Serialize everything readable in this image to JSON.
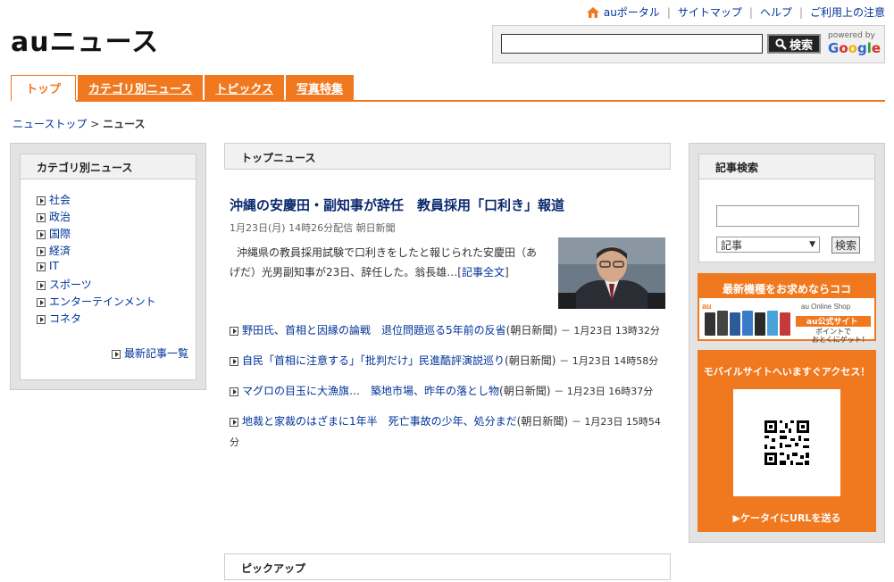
{
  "logo": {
    "text": "auニュース"
  },
  "topnav": {
    "items": [
      "auポータル",
      "サイトマップ",
      "ヘルプ",
      "ご利用上の注意"
    ]
  },
  "search": {
    "button_label": "検索",
    "powered_by": "powered by",
    "provider": "Google"
  },
  "tabs": [
    "トップ",
    "カテゴリ別ニュース",
    "トピックス",
    "写真特集"
  ],
  "breadcrumb": {
    "parent": "ニューストップ",
    "current": "ニュース"
  },
  "sidebar_left": {
    "title": "カテゴリ別ニュース",
    "categories": [
      "社会",
      "政治",
      "国際",
      "経済",
      "IT",
      "スポーツ",
      "エンターテインメント",
      "コネタ"
    ],
    "more_link": "最新記事一覧"
  },
  "top_news": {
    "section_title": "トップニュース",
    "headline": "沖縄の安慶田・副知事が辞任　教員採用「口利き」報道",
    "meta": "1月23日(月) 14時26分配信 朝日新聞",
    "body": "沖縄県の教員採用試験で口利きをしたと報じられた安慶田（あげだ）光男副知事が23日、辞任した。翁長雄…",
    "read_more": "記事全文",
    "items": [
      {
        "title": "野田氏、首相と因縁の論戦　退位問題巡る5年前の反省",
        "source": "(朝日新聞)",
        "time": "－ 1月23日 13時32分"
      },
      {
        "title": "自民「首相に注意する」「批判だけ」民進酷評演説巡り",
        "source": "(朝日新聞)",
        "time": "－ 1月23日 14時58分"
      },
      {
        "title": "マグロの目玉に大漁旗…　築地市場、昨年の落とし物",
        "source": "(朝日新聞)",
        "time": "－ 1月23日 16時37分"
      },
      {
        "title": "地裁と家裁のはざまに1年半　死亡事故の少年、処分まだ",
        "source": "(朝日新聞)",
        "time": "－ 1月23日 15時54分"
      }
    ]
  },
  "pickup": {
    "section_title": "ピックアップ"
  },
  "sidebar_right": {
    "title": "記事検索",
    "select_value": "記事",
    "search_label": "検索",
    "banner1_title": "最新機種をお求めならココ",
    "banner1_shop": "au Online Shop",
    "banner1_site": "au公式サイト",
    "banner1_point": "ポイントで",
    "banner1_deal": "おとくにゲット！",
    "banner2_title": "モバイルサイトへいますぐアクセス！",
    "banner2_send": "ケータイにURLを送る"
  },
  "colors": {
    "accent": "#f07920",
    "link": "#003399"
  }
}
